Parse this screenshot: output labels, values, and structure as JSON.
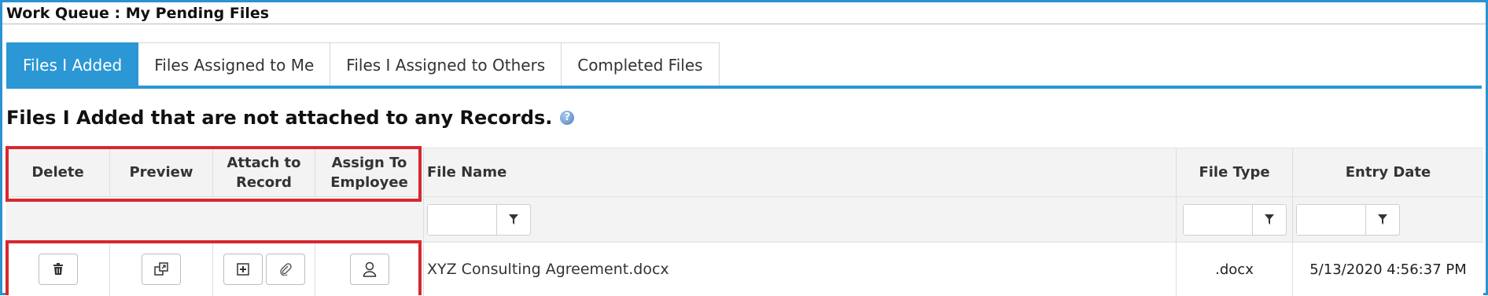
{
  "window": {
    "title": "Work Queue : My Pending Files"
  },
  "tabs": [
    {
      "label": "Files I Added",
      "active": true
    },
    {
      "label": "Files Assigned to Me",
      "active": false
    },
    {
      "label": "Files I Assigned to Others",
      "active": false
    },
    {
      "label": "Completed Files",
      "active": false
    }
  ],
  "section": {
    "title": "Files I Added that are not attached to any Records."
  },
  "table": {
    "headers": {
      "delete": "Delete",
      "preview": "Preview",
      "attach": "Attach to Record",
      "assign": "Assign To Employee",
      "file_name": "File Name",
      "file_type": "File Type",
      "entry_date": "Entry Date"
    },
    "rows": [
      {
        "file_name": "XYZ Consulting Agreement.docx",
        "file_type": ".docx",
        "entry_date": "5/13/2020 4:56:37 PM"
      }
    ]
  },
  "icons": {
    "delete": "trash-icon",
    "preview": "preview-window-icon",
    "attach_add": "plus-icon",
    "attach_link": "paperclip-icon",
    "assign": "person-icon",
    "filter": "funnel-icon",
    "help": "help-icon"
  },
  "colors": {
    "accent": "#2b97d4",
    "highlight": "#d7282f",
    "frame": "#2b93cf"
  }
}
